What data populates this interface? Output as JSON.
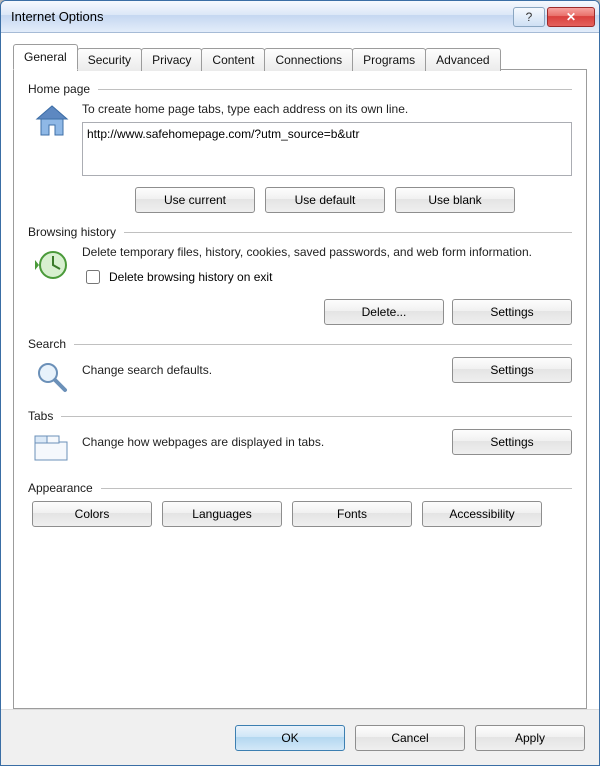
{
  "window": {
    "title": "Internet Options",
    "help_icon": "?",
    "close_icon": "✕"
  },
  "tabs": [
    {
      "label": "General"
    },
    {
      "label": "Security"
    },
    {
      "label": "Privacy"
    },
    {
      "label": "Content"
    },
    {
      "label": "Connections"
    },
    {
      "label": "Programs"
    },
    {
      "label": "Advanced"
    }
  ],
  "homepage": {
    "legend": "Home page",
    "desc": "To create home page tabs, type each address on its own line.",
    "value": "http://www.safehomepage.com/?utm_source=b&utr",
    "use_current": "Use current",
    "use_default": "Use default",
    "use_blank": "Use blank"
  },
  "history": {
    "legend": "Browsing history",
    "desc": "Delete temporary files, history, cookies, saved passwords, and web form information.",
    "checkbox_label": "Delete browsing history on exit",
    "delete_btn": "Delete...",
    "settings_btn": "Settings"
  },
  "search": {
    "legend": "Search",
    "desc": "Change search defaults.",
    "settings_btn": "Settings"
  },
  "tabs_group": {
    "legend": "Tabs",
    "desc": "Change how webpages are displayed in tabs.",
    "settings_btn": "Settings"
  },
  "appearance": {
    "legend": "Appearance",
    "colors": "Colors",
    "languages": "Languages",
    "fonts": "Fonts",
    "accessibility": "Accessibility"
  },
  "footer": {
    "ok": "OK",
    "cancel": "Cancel",
    "apply": "Apply"
  }
}
